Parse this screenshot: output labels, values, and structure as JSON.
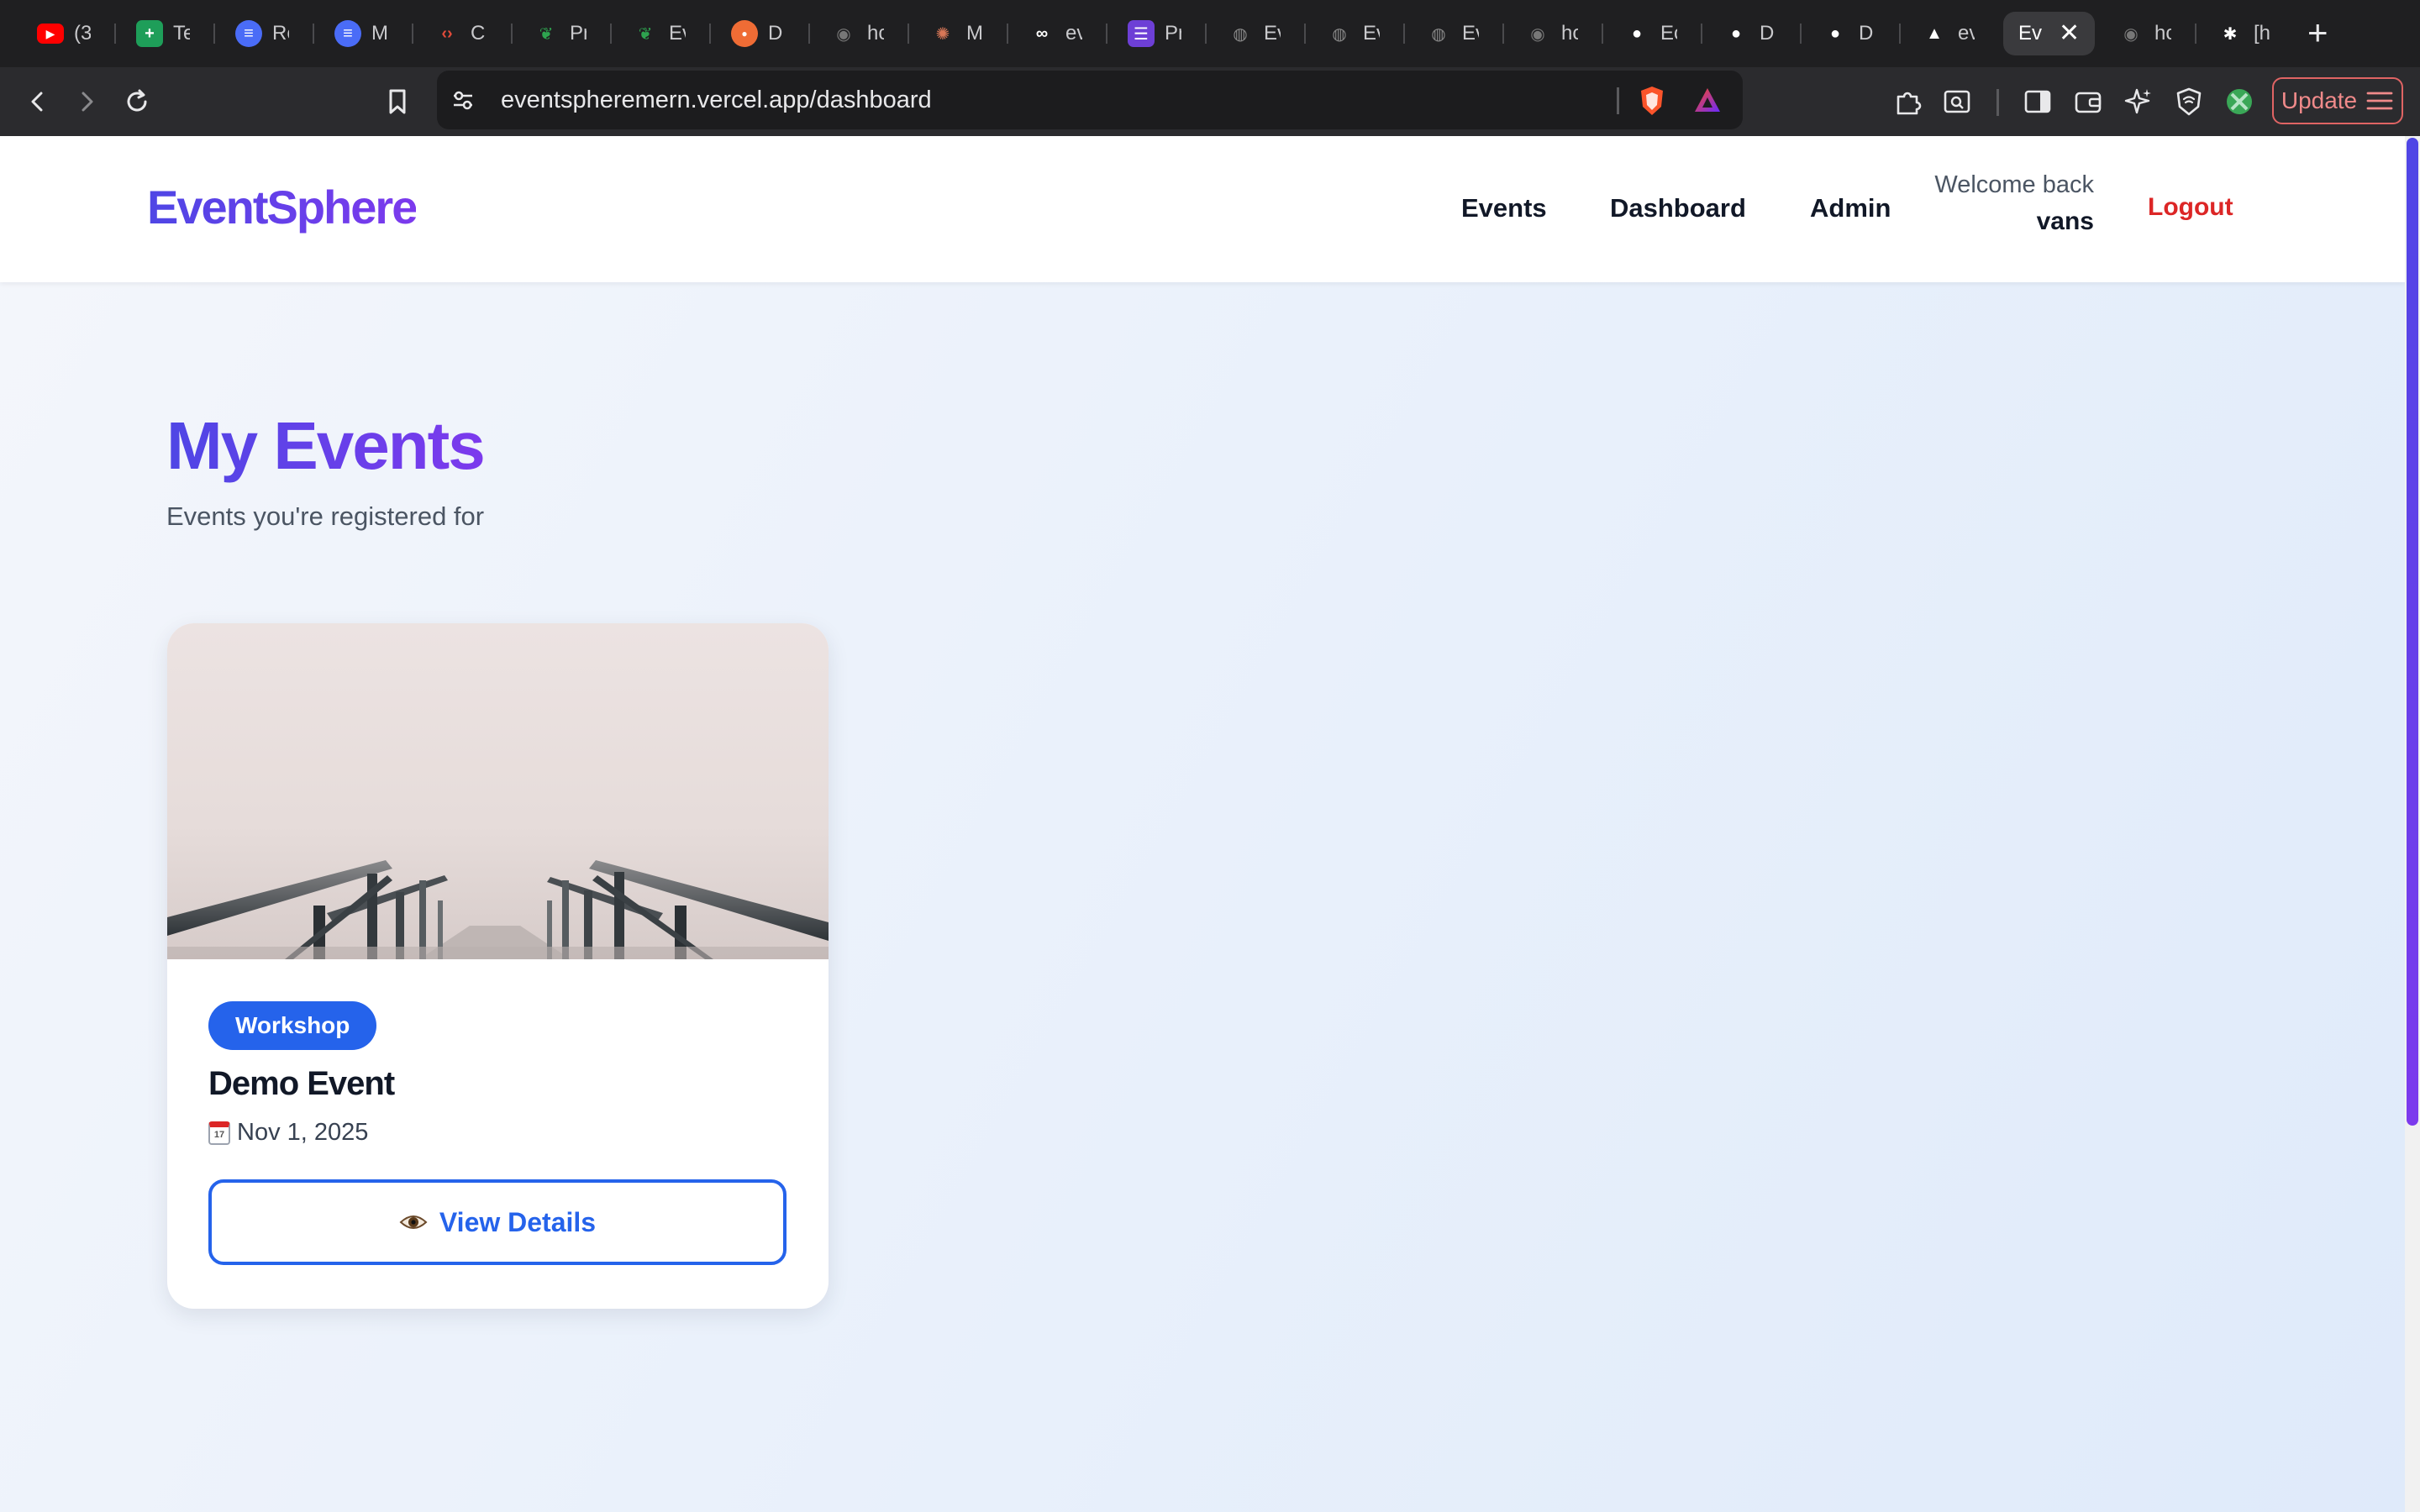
{
  "browser": {
    "tabs": [
      {
        "text": "(3",
        "icon": "youtube-icon",
        "color": "#ff0000"
      },
      {
        "text": "Te",
        "icon": "sheets-icon",
        "color": "#1e9e59"
      },
      {
        "text": "Re",
        "icon": "doc-lines-icon",
        "color": "#4a6cf7"
      },
      {
        "text": "M",
        "icon": "doc-lines-icon",
        "color": "#4a6cf7"
      },
      {
        "text": "C",
        "icon": "code-icon",
        "color": "#e34b3a"
      },
      {
        "text": "Pr",
        "icon": "mongodb-leaf-icon",
        "color": "#2ea44f"
      },
      {
        "text": "Ev",
        "icon": "mongodb-leaf-icon",
        "color": "#2ea44f"
      },
      {
        "text": "D",
        "icon": "postman-icon",
        "color": "#ef6c35"
      },
      {
        "text": "hc",
        "icon": "brave-shield-icon",
        "color": "#777777"
      },
      {
        "text": "M",
        "icon": "sparkle-icon",
        "color": "#d97757"
      },
      {
        "text": "ev",
        "icon": "link-icon",
        "color": "#ffffff"
      },
      {
        "text": "Pr",
        "icon": "list-icon",
        "color": "#6d3fd6"
      },
      {
        "text": "Ev",
        "icon": "globe-icon",
        "color": "#888888"
      },
      {
        "text": "Ev",
        "icon": "globe-icon",
        "color": "#888888"
      },
      {
        "text": "Ev",
        "icon": "globe-icon",
        "color": "#888888"
      },
      {
        "text": "hc",
        "icon": "brave-shield-icon",
        "color": "#777777"
      },
      {
        "text": "Ec",
        "icon": "github-icon",
        "color": "#ffffff"
      },
      {
        "text": "D",
        "icon": "github-icon",
        "color": "#ffffff"
      },
      {
        "text": "D",
        "icon": "github-icon",
        "color": "#ffffff"
      },
      {
        "text": "ev",
        "icon": "vercel-icon",
        "color": "#ffffff"
      },
      {
        "text": "Ev",
        "icon": "",
        "color": "",
        "active": true
      },
      {
        "text": "hc",
        "icon": "brave-shield-icon",
        "color": "#777777"
      },
      {
        "text": "[h",
        "icon": "spider-icon",
        "color": "#ffffff"
      }
    ],
    "new_tab_label": "+",
    "close_label": "✕",
    "url": "eventspheremern.vercel.app/dashboard",
    "update_label": "Update"
  },
  "nav": {
    "brand": "EventSphere",
    "links": [
      "Events",
      "Dashboard",
      "Admin"
    ],
    "welcome": "Welcome back",
    "username": "vans",
    "logout": "Logout"
  },
  "main": {
    "title": "My Events",
    "subtitle": "Events you're registered for"
  },
  "events": [
    {
      "category": "Workshop",
      "title": "Demo Event",
      "date": "Nov 1, 2025",
      "button_label": "View Details",
      "button_icon": "eye-icon"
    }
  ],
  "colors": {
    "brand_gradient_start": "#4f46e5",
    "brand_gradient_end": "#7c3aed",
    "primary": "#2563eb",
    "logout": "#dc2626"
  }
}
